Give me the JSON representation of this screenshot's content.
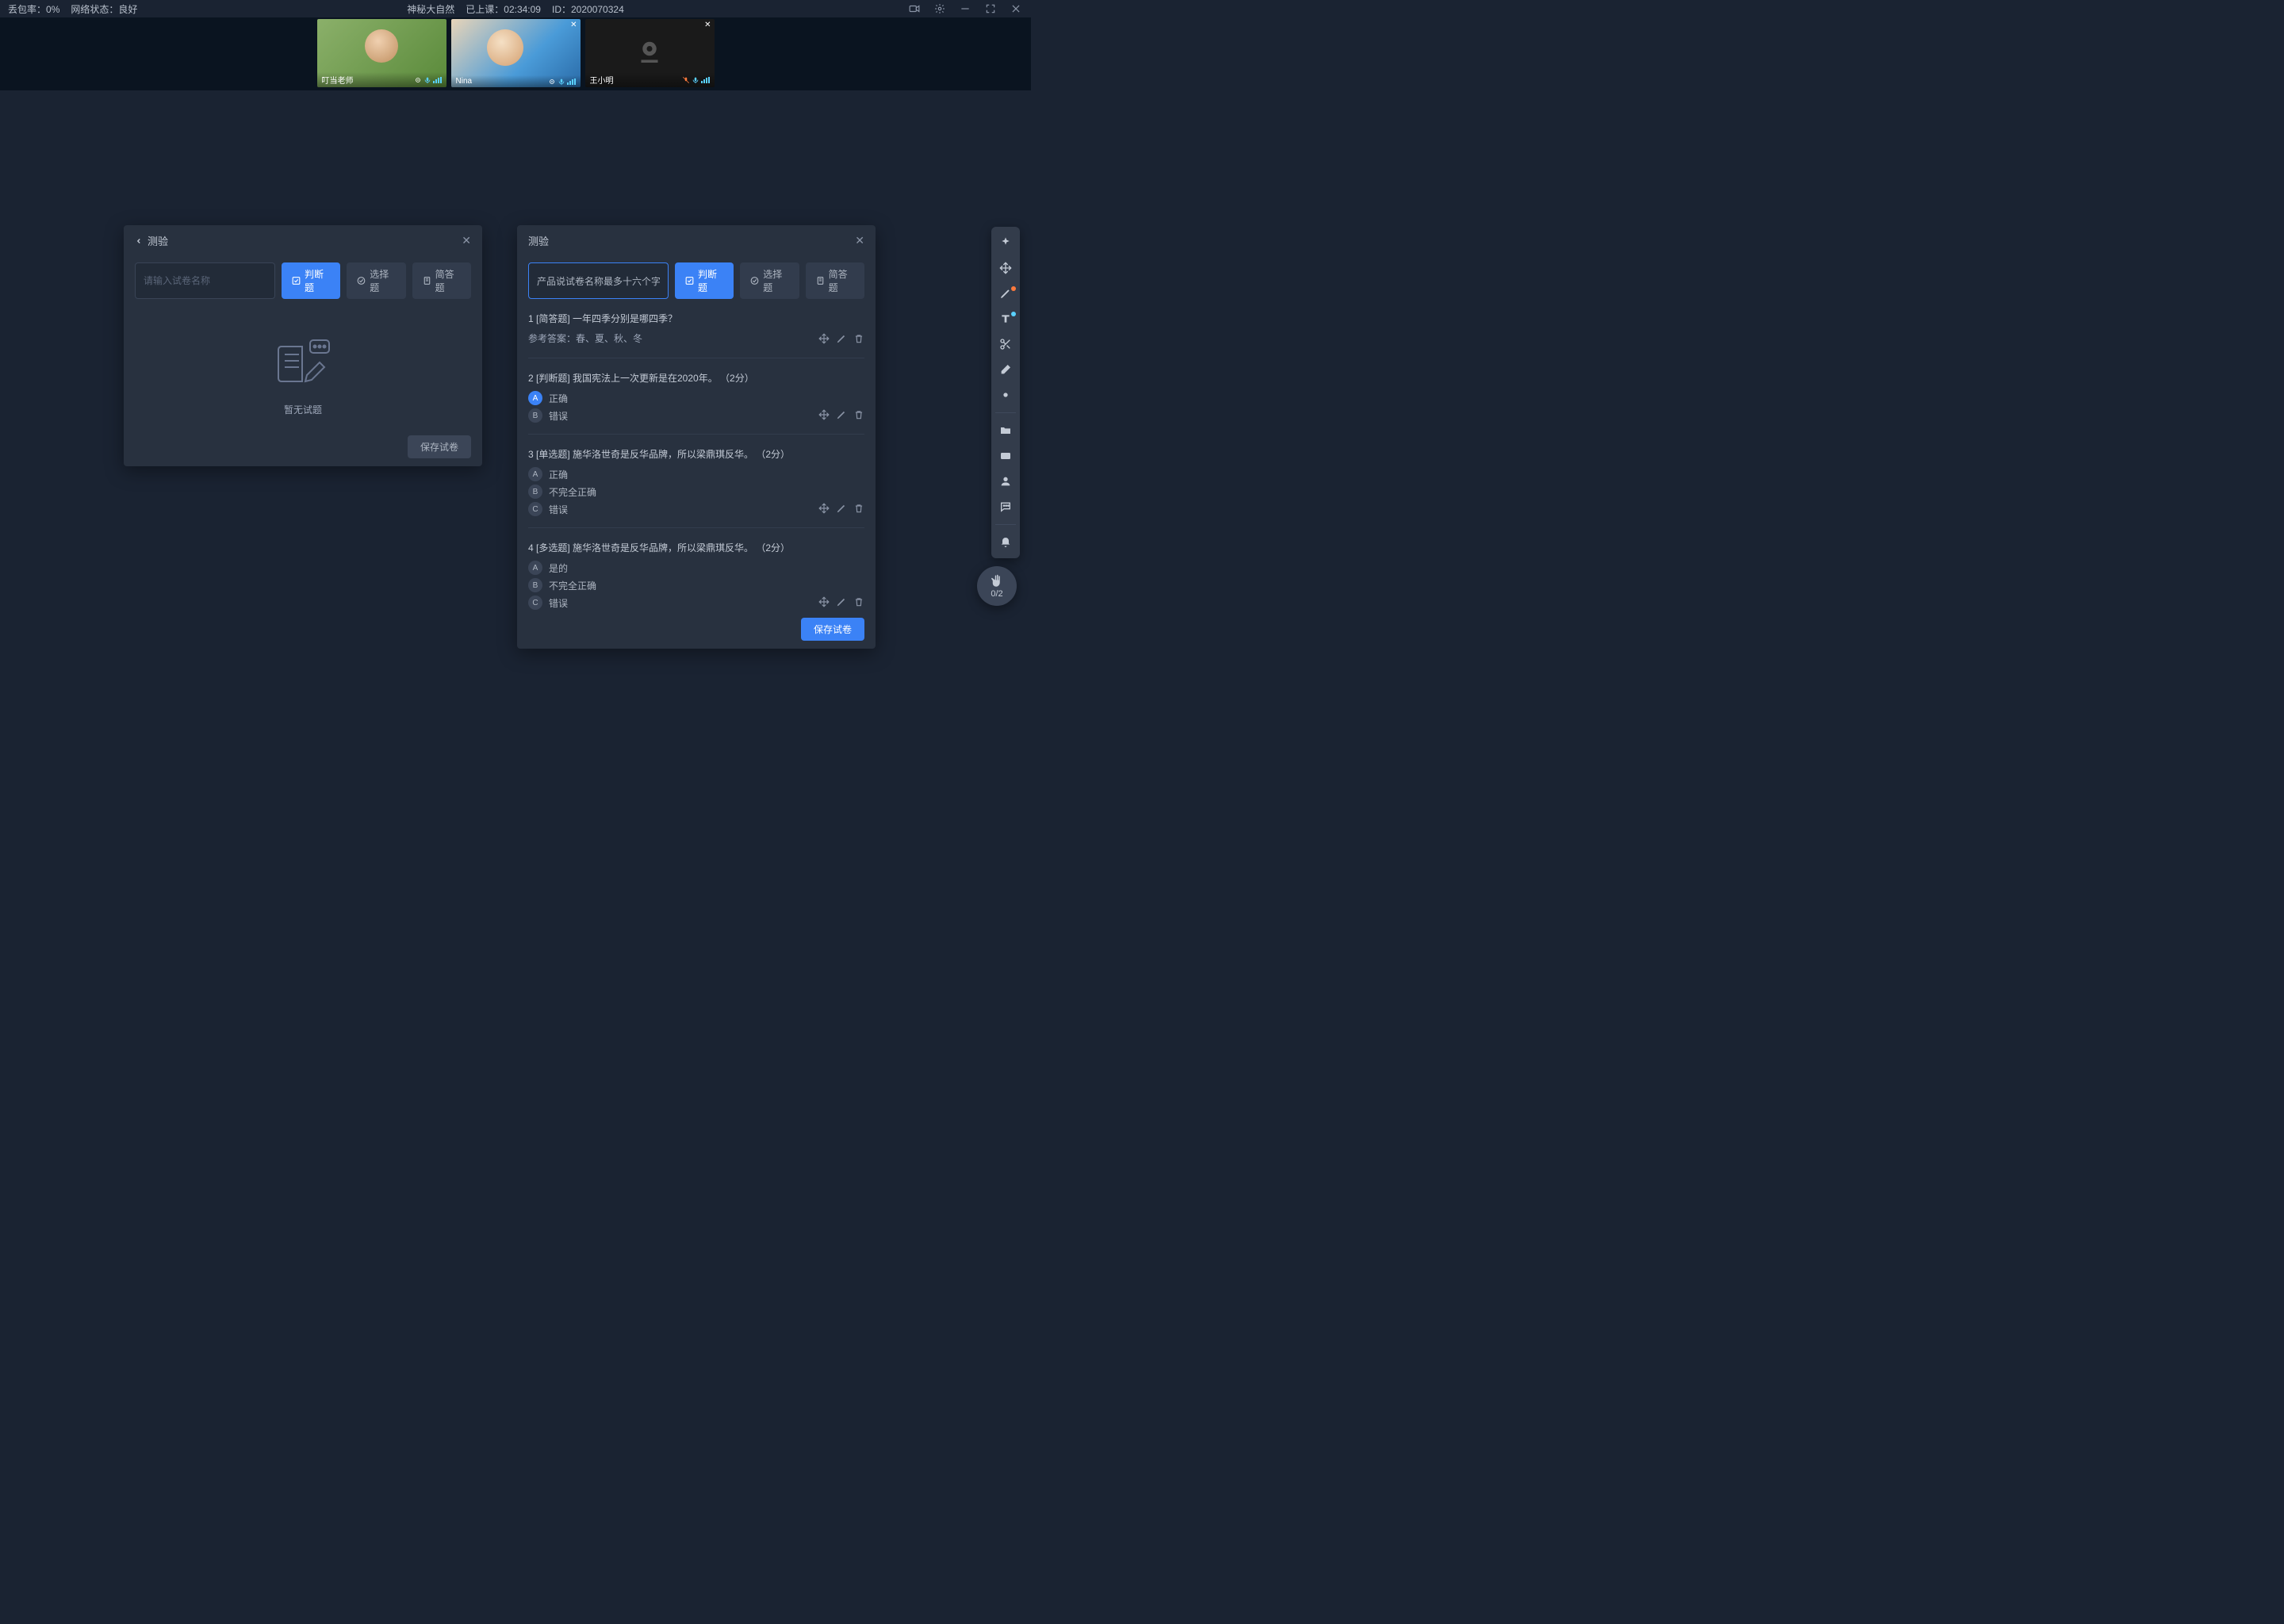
{
  "topbar": {
    "packet_loss_label": "丢包率：",
    "packet_loss_value": "0%",
    "network_label": "网络状态：",
    "network_value": "良好",
    "class_name": "神秘大自然",
    "elapsed_label": "已上课：",
    "elapsed_value": "02:34:09",
    "id_label": "ID：",
    "id_value": "2020070324"
  },
  "videos": [
    {
      "name": "叮当老师",
      "type": "teacher",
      "has_close": false
    },
    {
      "name": "Nina",
      "type": "nina",
      "has_close": true
    },
    {
      "name": "王小明",
      "type": "off",
      "has_close": true
    }
  ],
  "panelLeft": {
    "title": "测验",
    "placeholder": "请输入试卷名称",
    "tabs": {
      "judge": "判断题",
      "choice": "选择题",
      "short": "简答题"
    },
    "empty": "暂无试题",
    "save": "保存试卷"
  },
  "panelRight": {
    "title": "测验",
    "search_value": "产品说试卷名称最多十六个字",
    "tabs": {
      "judge": "判断题",
      "choice": "选择题",
      "short": "简答题"
    },
    "save": "保存试卷",
    "questions": [
      {
        "num": "1",
        "tag": "[简答题]",
        "text": "一年四季分别是哪四季？",
        "answer_label": "参考答案：",
        "answer": "春、夏、秋、冬",
        "options": []
      },
      {
        "num": "2",
        "tag": "[判断题]",
        "text": "我国宪法上一次更新是在2020年。",
        "pts": "（2分）",
        "options": [
          {
            "label": "A",
            "text": "正确",
            "correct": true
          },
          {
            "label": "B",
            "text": "错误"
          }
        ]
      },
      {
        "num": "3",
        "tag": "[单选题]",
        "text": "施华洛世奇是反华品牌，所以梁鼎琪反华。",
        "pts": "（2分）",
        "options": [
          {
            "label": "A",
            "text": "正确"
          },
          {
            "label": "B",
            "text": "不完全正确"
          },
          {
            "label": "C",
            "text": "错误"
          }
        ]
      },
      {
        "num": "4",
        "tag": "[多选题]",
        "text": "施华洛世奇是反华品牌，所以梁鼎琪反华。",
        "pts": "（2分）",
        "options": [
          {
            "label": "A",
            "text": "是的"
          },
          {
            "label": "B",
            "text": "不完全正确"
          },
          {
            "label": "C",
            "text": "错误"
          }
        ]
      }
    ]
  },
  "handBadge": {
    "count": "0/2"
  }
}
